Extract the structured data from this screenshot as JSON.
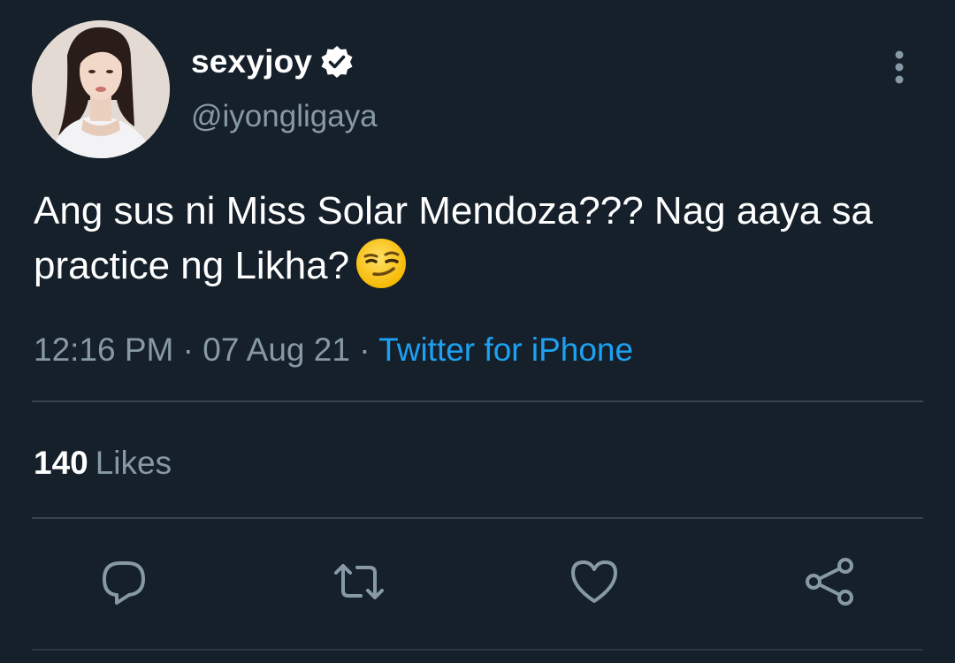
{
  "tweet": {
    "author": {
      "display_name": "sexyjoy",
      "handle": "@iyongligaya",
      "verified": true,
      "avatar": "profile-photo"
    },
    "text": "Ang sus ni Miss Solar Mendoza??? Nag aaya sa practice ng Likha?",
    "emoji": "smirking-face-emoji",
    "time": "12:16 PM",
    "separator": "·",
    "date": "07 Aug 21",
    "source": "Twitter for iPhone",
    "likes_count": "140",
    "likes_label": "Likes"
  },
  "actions": [
    {
      "icon": "reply-icon"
    },
    {
      "icon": "retweet-icon"
    },
    {
      "icon": "like-icon"
    },
    {
      "icon": "share-icon"
    }
  ],
  "colors": {
    "background": "#15202b",
    "text_primary": "#ffffff",
    "text_secondary": "#8899a6",
    "link": "#1da1f2",
    "divider": "#38444d"
  }
}
